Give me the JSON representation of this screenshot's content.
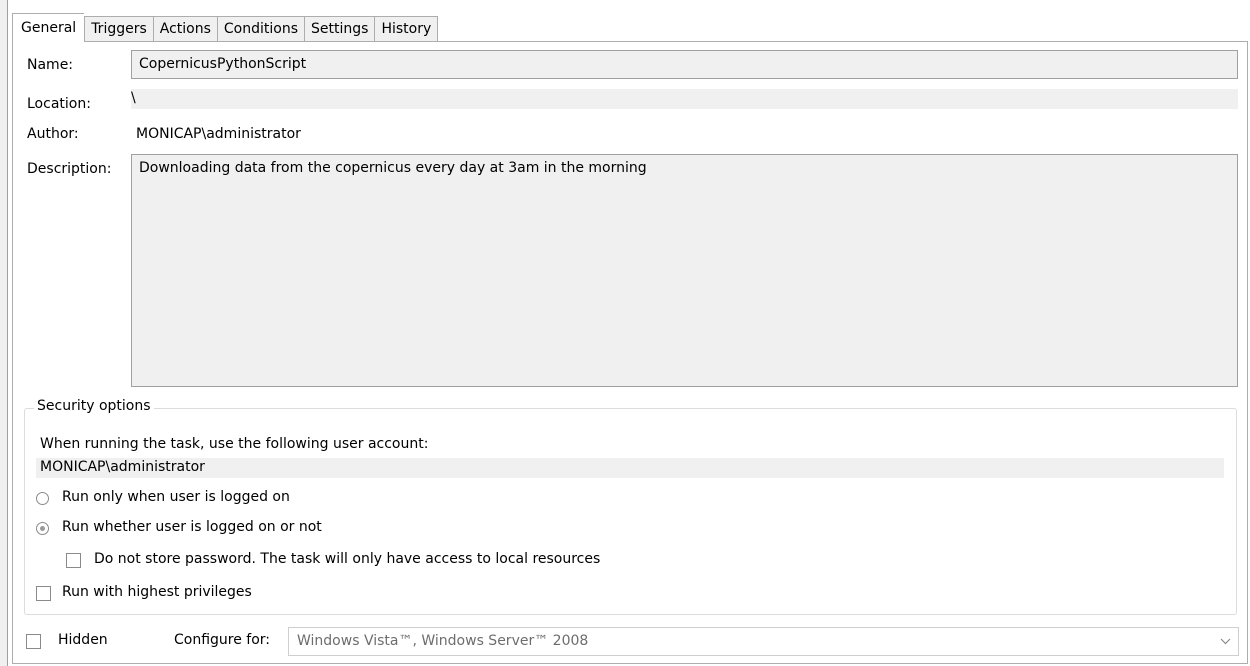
{
  "tabs": [
    {
      "label": "General",
      "active": true
    },
    {
      "label": "Triggers"
    },
    {
      "label": "Actions"
    },
    {
      "label": "Conditions"
    },
    {
      "label": "Settings"
    },
    {
      "label": "History"
    }
  ],
  "general": {
    "name_label": "Name:",
    "name_value": "CopernicusPythonScript",
    "location_label": "Location:",
    "location_value": "\\",
    "author_label": "Author:",
    "author_value": "MONICAP\\administrator",
    "description_label": "Description:",
    "description_value": "Downloading data from the copernicus every day at 3am in the morning"
  },
  "security": {
    "group_title": "Security options",
    "account_prompt": "When running the task, use the following user account:",
    "account_value": "MONICAP\\administrator",
    "radio_logged_on": {
      "label": "Run only when user is logged on",
      "checked": false
    },
    "radio_whether": {
      "label": "Run whether user is logged on or not",
      "checked": true
    },
    "do_not_store_password": {
      "label": "Do not store password.  The task will only have access to local resources",
      "checked": false
    },
    "highest_privileges": {
      "label": "Run with highest privileges",
      "checked": false
    }
  },
  "footer": {
    "hidden_label": "Hidden",
    "configure_label": "Configure for:",
    "configure_value": "Windows Vista™, Windows Server™ 2008"
  }
}
